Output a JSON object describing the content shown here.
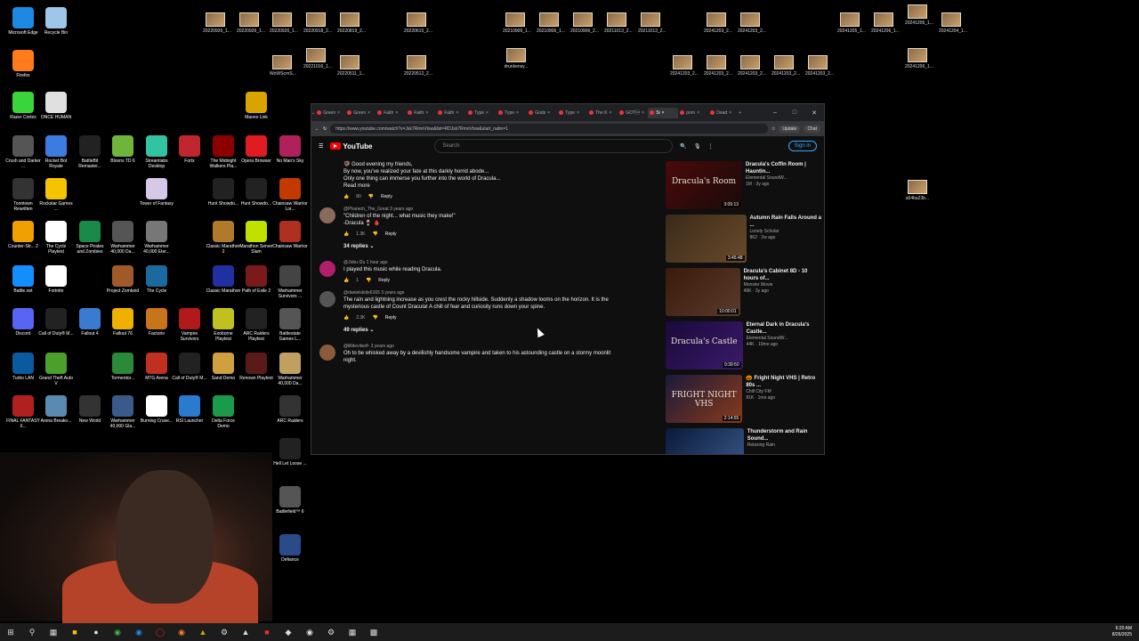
{
  "desktop": {
    "icons": [
      {
        "label": "Microsoft Edge",
        "color": "#1e88e5"
      },
      {
        "label": "Recycle Bin",
        "color": "#9ec6e8"
      },
      {
        "label": "Firefox",
        "color": "#ff7b1c"
      },
      {
        "label": "Razer Cortex",
        "color": "#3ad53a"
      },
      {
        "label": "ONCE HUMAN",
        "color": "#e0e0e0"
      },
      {
        "label": "Maono Link",
        "color": "#d9a400"
      },
      {
        "label": "Crush and Darker ...",
        "color": "#555"
      },
      {
        "label": "Rocket Bot Royale",
        "color": "#3c7be0"
      },
      {
        "label": "BattleBit Remaster...",
        "color": "#222"
      },
      {
        "label": "Bloons TD 6",
        "color": "#6fb43b"
      },
      {
        "label": "Streamlabs Desktop",
        "color": "#31c3a2"
      },
      {
        "label": "Fortx",
        "color": "#c0262e"
      },
      {
        "label": "The Midnight Walkers Pla...",
        "color": "#8b0000"
      },
      {
        "label": "Opera Browser",
        "color": "#e01b22"
      },
      {
        "label": "No Man's Sky",
        "color": "#b0205a"
      },
      {
        "label": "Toontown Rewritten",
        "color": "#333"
      },
      {
        "label": "Rockstar Games ...",
        "color": "#f5c400"
      },
      {
        "label": "Tower of Fantasy",
        "color": "#d8c8e8"
      },
      {
        "label": "Hunt Showdo...",
        "color": "#222"
      },
      {
        "label": "Hunt Showdo...",
        "color": "#222"
      },
      {
        "label": "Chainsaw Warrior Lor...",
        "color": "#c23a00"
      },
      {
        "label": "Counter-Str... 2",
        "color": "#f0a000"
      },
      {
        "label": "The Cycle Playtest",
        "color": "#fff"
      },
      {
        "label": "Space Pirates and Zombies",
        "color": "#1a8a4a"
      },
      {
        "label": "Warhammer 40,000 Da...",
        "color": "#555"
      },
      {
        "label": "Warhammer 40,000 Eter...",
        "color": "#777"
      },
      {
        "label": "Classic Marathon 2",
        "color": "#b07a2a"
      },
      {
        "label": "Marathon Server Slam",
        "color": "#c0e000"
      },
      {
        "label": "Chainsaw Warrior",
        "color": "#b03020"
      },
      {
        "label": "Battle.net",
        "color": "#148eff"
      },
      {
        "label": "Fortnite",
        "color": "#fff"
      },
      {
        "label": "Project Zomboid",
        "color": "#a05a2a"
      },
      {
        "label": "The Cycle",
        "color": "#1a6aa0"
      },
      {
        "label": "Classic Marathon",
        "color": "#2030a0"
      },
      {
        "label": "Path of Exile 2",
        "color": "#7a1a1a"
      },
      {
        "label": "Warhammer Survivors ...",
        "color": "#444"
      },
      {
        "label": "Discord",
        "color": "#5865f2"
      },
      {
        "label": "Call of Duty® M...",
        "color": "#222"
      },
      {
        "label": "Fallout 4",
        "color": "#3a7ad0"
      },
      {
        "label": "Fallout 76",
        "color": "#f0b000"
      },
      {
        "label": "Factorio",
        "color": "#c8741a"
      },
      {
        "label": "Vampire Survivors",
        "color": "#b01a1a"
      },
      {
        "label": "Exoborne Playtest",
        "color": "#c0c020"
      },
      {
        "label": "ARC Raiders Playtest",
        "color": "#222"
      },
      {
        "label": "Battlestate Games L...",
        "color": "#555"
      },
      {
        "label": "Turbo LAN",
        "color": "#0a5aa0"
      },
      {
        "label": "Grand Theft Auto V",
        "color": "#4aa02a"
      },
      {
        "label": "Tormentor...",
        "color": "#2a8a3a"
      },
      {
        "label": "MTG Arena",
        "color": "#c03020"
      },
      {
        "label": "Call of Duty® M...",
        "color": "#222"
      },
      {
        "label": "Sand Demo",
        "color": "#d0a040"
      },
      {
        "label": "Renown Playtest",
        "color": "#5a1a1a"
      },
      {
        "label": "Warhammer 40,000 Da...",
        "color": "#c0a060"
      },
      {
        "label": "FINAL FANTASY X...",
        "color": "#b02020"
      },
      {
        "label": "Arena Breako...",
        "color": "#5a8ab0"
      },
      {
        "label": "New World",
        "color": "#333"
      },
      {
        "label": "Warhammer 40,000 Gla...",
        "color": "#3a5a8a"
      },
      {
        "label": "Burning Cruse...",
        "color": "#fff"
      },
      {
        "label": "RSI Launcher",
        "color": "#2a7ad0"
      },
      {
        "label": "Delta Force Demo",
        "color": "#1a9a4a"
      },
      {
        "label": "ARC Raiders",
        "color": "#333"
      },
      {
        "label": "Hell Let Loose ...",
        "color": "#222"
      },
      {
        "label": "Battlefield™ 6",
        "color": "#555"
      },
      {
        "label": "Defiance",
        "color": "#2a4a8a"
      }
    ],
    "thumbs": [
      "20220926_1...",
      "20220926_1...",
      "20220926_1...",
      "20220918_2...",
      "20220819_2...",
      "20220615_2...",
      "20210906_1...",
      "20210906_1...",
      "20210906_2...",
      "20211013_2...",
      "20211013_2...",
      "20241203_2...",
      "20241203_2...",
      "20241205_1...",
      "20241206_1...",
      "20241206_1...",
      "20241204_1...",
      "WoWScrnS...",
      "20221016_1...",
      "20220511_1...",
      "20220512_2...",
      "drunkensy...",
      "20241203_2...",
      "20241203_2...",
      "20241203_2...",
      "20241203_2...",
      "20241203_2...",
      "20241206_1...",
      "a54ba23b..."
    ]
  },
  "browser": {
    "tabs": [
      "Green",
      "Green",
      "Faith",
      "Faith",
      "Faith",
      "Type",
      "Type",
      "Gods",
      "Type",
      "The K",
      "GOT\u0001",
      "Si",
      "porn",
      "Dead"
    ],
    "url": "https://www.youtube.com/watch?v=Jsk7RmnVtsw&list=RDJsk7RmnVtsw&start_radio=1",
    "update_label": "Update",
    "chat_label": "Chat",
    "window_buttons": [
      "–",
      "□",
      "✕"
    ]
  },
  "youtube": {
    "logo": "YouTube",
    "search_placeholder": "Search",
    "sign_in": "Sign in",
    "comments": [
      {
        "author": "",
        "time": "",
        "lines": [
          "🦃 Good evening my friends,",
          "",
          "By now, you've realized your fate at this darkly horrid abode...",
          "Only one thing can immerse you further into the world of Dracula..."
        ],
        "read_more": "Read more",
        "likes": "80",
        "reply": "Reply"
      },
      {
        "author": "@Pharaoh_The_Great",
        "time": "3 years ago",
        "lines": [
          "\"Children of the night... what music they make!\"",
          "-Dracula 🍷 🩸"
        ],
        "likes": "1.3K",
        "reply": "Reply",
        "replies": "34 replies"
      },
      {
        "author": "@Jobu-l2u",
        "time": "1 hour ago",
        "lines": [
          "I played this music while reading Dracula."
        ],
        "likes": "1",
        "reply": "Reply"
      },
      {
        "author": "@danielskids6165",
        "time": "3 years ago",
        "lines": [
          "The rain and lightning increase as you crest the rocky hillside. Suddenly a shadow looms on the horizon. It is the",
          "mysterious castle of Count Dracula! A chill of fear and curiosity runs down your spine."
        ],
        "likes": "2.3K",
        "reply": "Reply",
        "replies": "49 replies"
      },
      {
        "author": "@lilldevilself-",
        "time": "3 years ago",
        "lines": [
          "Oh to be whisked away by a devilishly handsome vampire and taken to his astounding castle on a stormy moonlit",
          "night."
        ]
      }
    ],
    "recommendations": [
      {
        "title": "Dracula's Coffin Room | Hauntin...",
        "channel": "Elemental SoundW...",
        "stats": "1M · 3y ago",
        "duration": "3:09:13",
        "thumb_text": "Dracula's Room",
        "color1": "#4a0a0a",
        "color2": "#1a0a0a"
      },
      {
        "title": "Autumn Rain Falls Around a ...",
        "channel": "Lonely Scholar",
        "stats": "862 · 2w ago",
        "duration": "3:45:48",
        "thumb_text": "",
        "color1": "#3a2a1a",
        "color2": "#6a4a2a"
      },
      {
        "title": "Dracula's Cabinet 8D - 10 hours of...",
        "channel": "Monster Movie",
        "stats": "49K · 3y ago",
        "duration": "10:00:01",
        "thumb_text": "",
        "color1": "#3a1a0a",
        "color2": "#5a3a2a"
      },
      {
        "title": "Eternal Dark in Dracula's Castle...",
        "channel": "Elemental SoundW...",
        "stats": "44K · 10mo ago",
        "duration": "9:39:50",
        "thumb_text": "Dracula's Castle",
        "color1": "#1a0a3a",
        "color2": "#3a1a6a"
      },
      {
        "title": "🎃 Fright Night VHS | Retro 80s ...",
        "channel": "Chill City FM",
        "stats": "81K · 1mo ago",
        "duration": "2:14:55",
        "thumb_text": "FRIGHT NIGHT VHS",
        "color1": "#1a1a3a",
        "color2": "#8a3a1a"
      },
      {
        "title": "Thunderstorm and Rain Sound...",
        "channel": "Relaxing Rain",
        "stats": "",
        "duration": "",
        "thumb_text": "",
        "color1": "#0a1a3a",
        "color2": "#3a5a8a"
      }
    ]
  },
  "taskbar": {
    "time": "6:20 AM",
    "date": "8/26/2025"
  }
}
